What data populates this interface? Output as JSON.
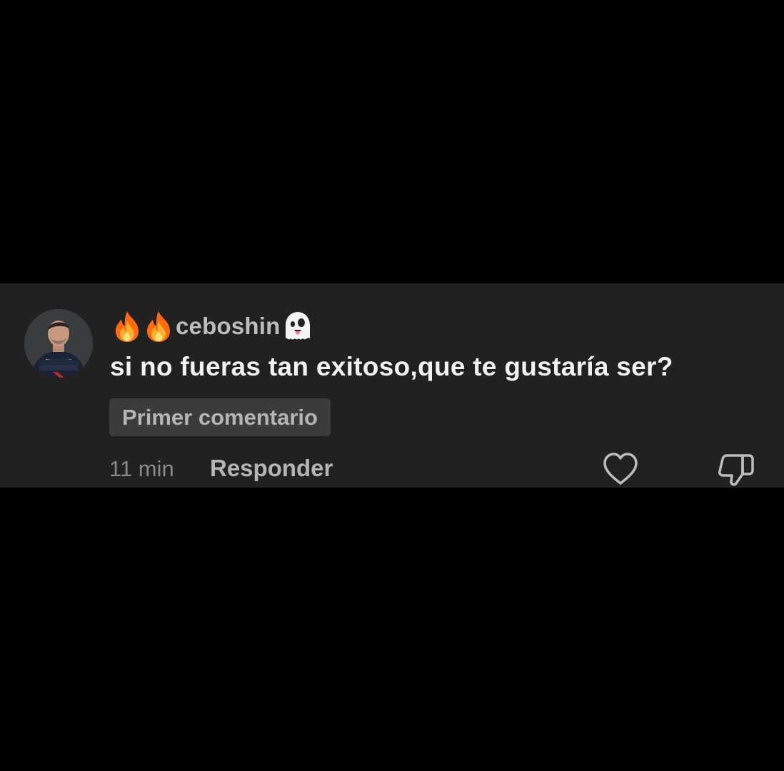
{
  "comment": {
    "username": "ceboshin",
    "username_prefix_icons": [
      "fire-icon",
      "fire-icon"
    ],
    "username_suffix_icon": "ghost-icon",
    "text": "si no fueras tan exitoso,que te gustaría ser?",
    "badge": "Primer comentario",
    "timestamp": "11 min",
    "reply_label": "Responder",
    "actions": [
      "heart-icon",
      "thumbs-down-icon"
    ]
  },
  "colors": {
    "background": "#000000",
    "card": "#212121",
    "text_primary": "#f2f2f2",
    "text_secondary": "#b5b5b5",
    "text_muted": "#8a8a8a",
    "badge_bg": "#3b3b3b"
  }
}
